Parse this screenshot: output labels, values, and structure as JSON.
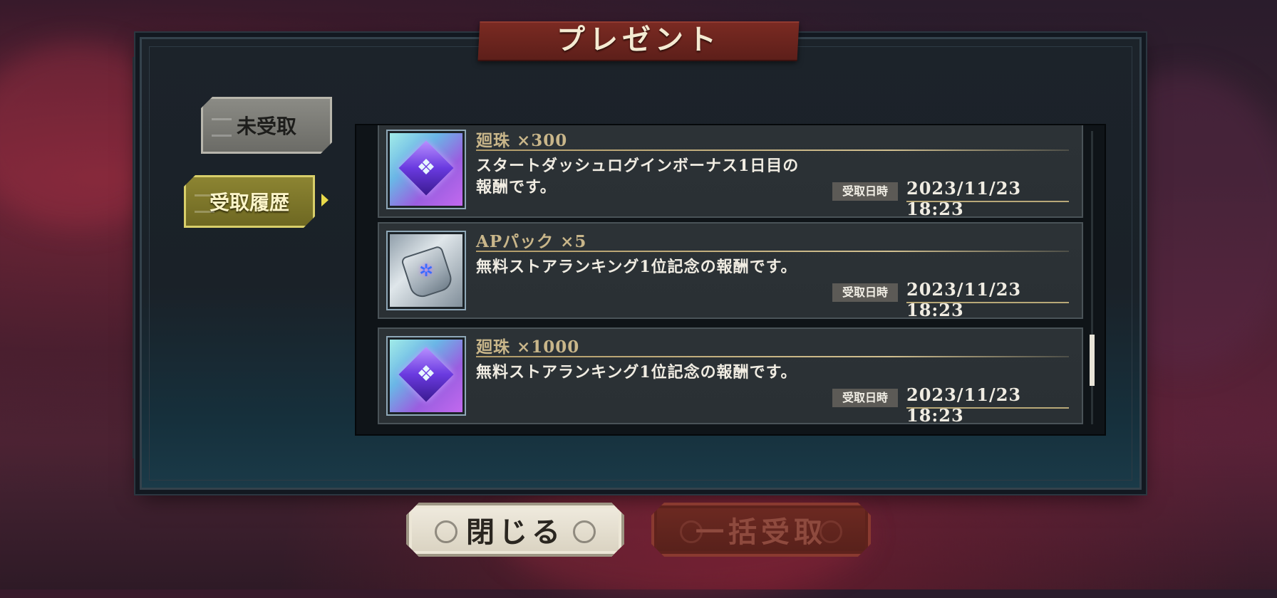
{
  "dialog": {
    "title": "プレゼント"
  },
  "tabs": [
    {
      "label": "未受取"
    },
    {
      "label": "受取履歴"
    }
  ],
  "items": [
    {
      "title": "廻珠 ×300",
      "description_line1": "スタートダッシュログインボーナス1日目の",
      "description_line2": "報酬です。",
      "date_label": "受取日時",
      "date": "2023/11/23 18:23",
      "icon": "orb-cube-icon"
    },
    {
      "title": "APパック ×5",
      "description_line1": "無料ストアランキング1位記念の報酬です。",
      "description_line2": "",
      "date_label": "受取日時",
      "date": "2023/11/23 18:23",
      "icon": "ap-pack-icon"
    },
    {
      "title": "廻珠 ×1000",
      "description_line1": "無料ストアランキング1位記念の報酬です。",
      "description_line2": "",
      "date_label": "受取日時",
      "date": "2023/11/23 18:23",
      "icon": "orb-cube-icon"
    }
  ],
  "buttons": {
    "close": "閉じる",
    "bulk_receive": "一括受取"
  },
  "colors": {
    "title_banner": "#6a241d",
    "active_tab": "#7d7629",
    "item_title": "#c9b68a",
    "close_button": "#e6e0d0",
    "bulk_button_disabled": "#5f231c"
  }
}
